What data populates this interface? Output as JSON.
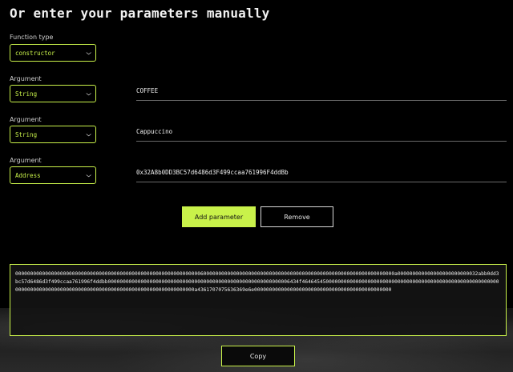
{
  "title": "Or enter your parameters manually",
  "function_type": {
    "label": "Function type",
    "value": "constructor"
  },
  "arguments": [
    {
      "label": "Argument",
      "type": "String",
      "value": "COFFEE"
    },
    {
      "label": "Argument",
      "type": "String",
      "value": "Cappuccino"
    },
    {
      "label": "Argument",
      "type": "Address",
      "value": "0x32A8b0DD3BC57d6486d3F499ccaa761996F4ddBb"
    }
  ],
  "buttons": {
    "add": "Add parameter",
    "remove": "Remove",
    "copy": "Copy"
  },
  "output": "0000000000000000000000000000000000000000000000000000000000000060000000000000000000000000000000000000000000000000000000000000000a000000000000000000000000032abb0dd3bc57d6486d3f499ccaa761996f4ddbb0000000000000000000000000000000000000000000000000000000000006434f464645450000000000000000000000000000000000000000000000000000000000000000000000000000000000000000000000000000000000000000000000a4361707075636369e6e0000000000000000000000000000000000000000000000",
  "colors": {
    "accent": "#c9f24a",
    "background": "#000000"
  },
  "icons": {
    "dropdown": "chevron-down-icon"
  }
}
